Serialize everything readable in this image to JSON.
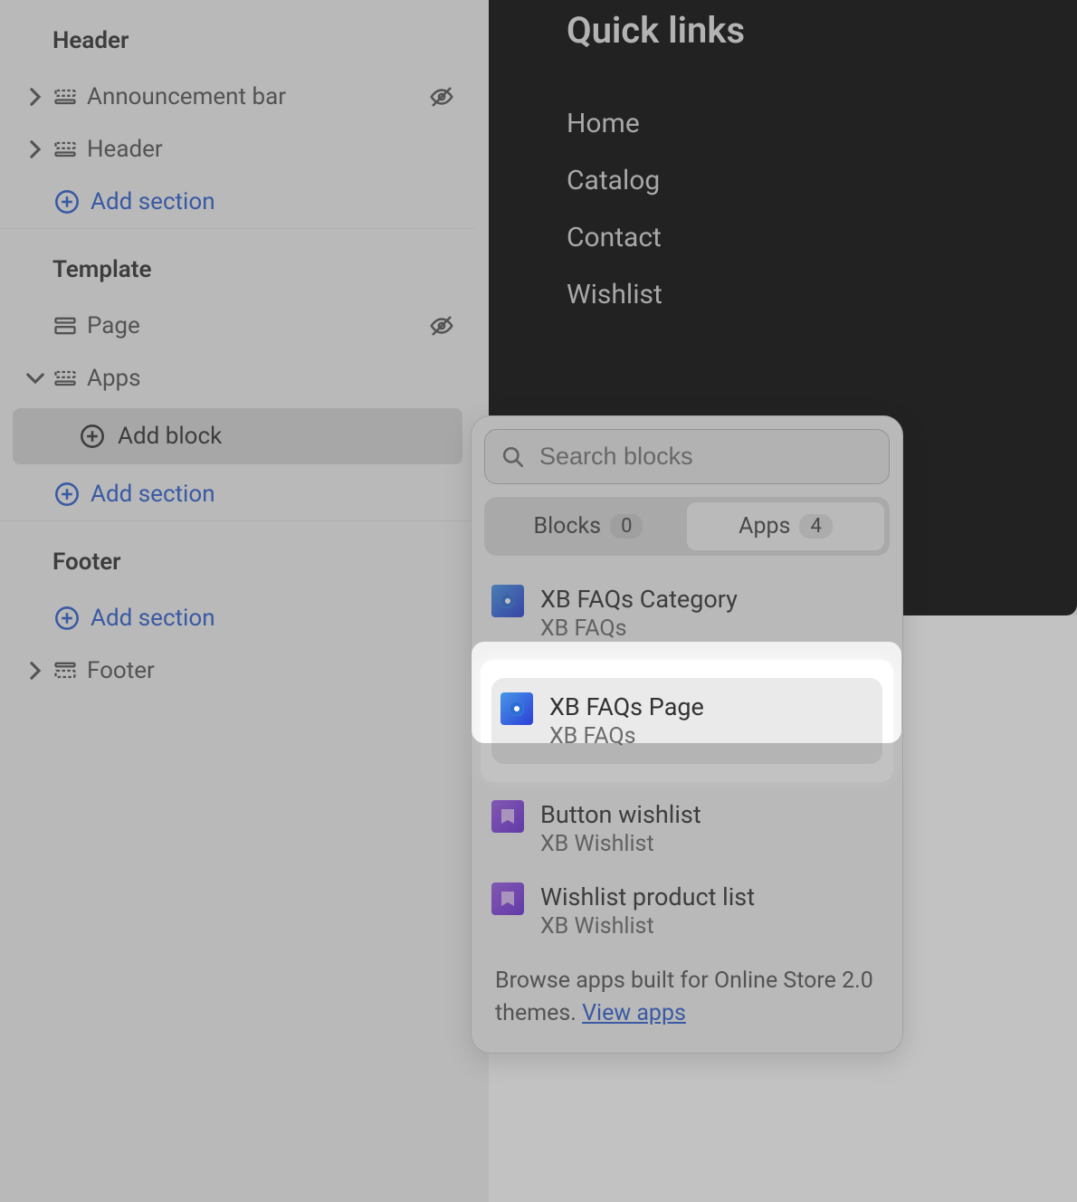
{
  "sidebar": {
    "groups": [
      {
        "title": "Header",
        "items": [
          {
            "label": "Announcement bar",
            "hidden": true,
            "expandable": true
          },
          {
            "label": "Header",
            "hidden": false,
            "expandable": true
          }
        ],
        "add_section_label": "Add section"
      },
      {
        "title": "Template",
        "items": [
          {
            "label": "Page",
            "hidden": true,
            "expandable": false
          },
          {
            "label": "Apps",
            "hidden": false,
            "expandable": true,
            "expanded": true,
            "add_block_label": "Add block"
          }
        ],
        "add_section_label": "Add section"
      },
      {
        "title": "Footer",
        "add_section_label": "Add section",
        "items": [
          {
            "label": "Footer",
            "hidden": false,
            "expandable": true
          }
        ]
      }
    ]
  },
  "preview": {
    "title": "Quick links",
    "links": [
      "Home",
      "Catalog",
      "Contact",
      "Wishlist"
    ]
  },
  "popup": {
    "search_placeholder": "Search blocks",
    "tabs": [
      {
        "label": "Blocks",
        "count": "0",
        "active": false
      },
      {
        "label": "Apps",
        "count": "4",
        "active": true
      }
    ],
    "items": [
      {
        "name": "XB FAQs Category",
        "source": "XB FAQs",
        "icon": "faq",
        "highlighted": false
      },
      {
        "name": "XB FAQs Page",
        "source": "XB FAQs",
        "icon": "faq",
        "highlighted": true
      },
      {
        "name": "Button wishlist",
        "source": "XB Wishlist",
        "icon": "wishlist",
        "highlighted": false
      },
      {
        "name": "Wishlist product list",
        "source": "XB Wishlist",
        "icon": "wishlist",
        "highlighted": false
      }
    ],
    "browse_text": "Browse apps built for Online Store 2.0 themes. ",
    "view_apps_label": "View apps"
  }
}
